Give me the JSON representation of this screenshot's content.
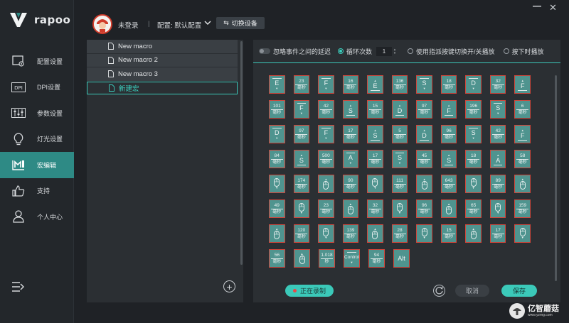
{
  "brand": {
    "name": "rapoo",
    "accent": "#3bc9b9",
    "active_nav": "#2e8a85",
    "cell_border": "#d0453a",
    "cell_fill": "#4f948f"
  },
  "sidebar": {
    "items": [
      {
        "label": "配置设置",
        "icon": "profile-settings-icon",
        "active": false
      },
      {
        "label": "DPI设置",
        "icon": "dpi-icon",
        "active": false
      },
      {
        "label": "参数设置",
        "icon": "sliders-icon",
        "active": false
      },
      {
        "label": "灯光设置",
        "icon": "bulb-icon",
        "active": false
      },
      {
        "label": "宏编辑",
        "icon": "macro-icon",
        "active": true
      },
      {
        "label": "支持",
        "icon": "thumbs-up-icon",
        "active": false
      },
      {
        "label": "个人中心",
        "icon": "user-icon",
        "active": false
      }
    ]
  },
  "header": {
    "login": "未登录",
    "separator": "|",
    "profile": "配置: 默认配置",
    "switch_device": "切换设备"
  },
  "macro_list": {
    "items": [
      "New macro",
      "New macro 2",
      "New macro 3",
      "新建宏"
    ],
    "selected_index": 3
  },
  "options": {
    "ignore_delay": "忽略事件之间的延迟",
    "loop_label": "循环次数",
    "loop_value": "1",
    "toggle_mode": "使用指派按键切换开/关播放",
    "hold_mode": "按下时播放"
  },
  "macro_cells": [
    [
      {
        "t": "key",
        "k": "E",
        "d": "down"
      },
      {
        "t": "delay",
        "v": "23",
        "u": "毫秒"
      },
      {
        "t": "key",
        "k": "F",
        "d": "down"
      },
      {
        "t": "delay",
        "v": "16",
        "u": "毫秒"
      },
      {
        "t": "key",
        "k": "E",
        "d": "up"
      },
      {
        "t": "delay",
        "v": "136",
        "u": "毫秒"
      },
      {
        "t": "key",
        "k": "S",
        "d": "down"
      },
      {
        "t": "delay",
        "v": "18",
        "u": "毫秒"
      },
      {
        "t": "key",
        "k": "D",
        "d": "down"
      },
      {
        "t": "delay",
        "v": "32",
        "u": "毫秒"
      },
      {
        "t": "key",
        "k": "F",
        "d": "up"
      }
    ],
    [
      {
        "t": "delay",
        "v": "101",
        "u": "毫秒"
      },
      {
        "t": "key",
        "k": "F",
        "d": "down"
      },
      {
        "t": "delay",
        "v": "42",
        "u": "毫秒"
      },
      {
        "t": "key",
        "k": "S",
        "d": "up"
      },
      {
        "t": "delay",
        "v": "15",
        "u": "毫秒"
      },
      {
        "t": "key",
        "k": "D",
        "d": "up"
      },
      {
        "t": "delay",
        "v": "97",
        "u": "毫秒"
      },
      {
        "t": "key",
        "k": "F",
        "d": "up"
      },
      {
        "t": "delay",
        "v": "196",
        "u": "毫秒"
      },
      {
        "t": "key",
        "k": "S",
        "d": "down"
      },
      {
        "t": "delay",
        "v": "6",
        "u": "毫秒"
      }
    ],
    [
      {
        "t": "key",
        "k": "D",
        "d": "down"
      },
      {
        "t": "delay",
        "v": "97",
        "u": "毫秒"
      },
      {
        "t": "key",
        "k": "F",
        "d": "down"
      },
      {
        "t": "delay",
        "v": "17",
        "u": "毫秒"
      },
      {
        "t": "key",
        "k": "S",
        "d": "up"
      },
      {
        "t": "delay",
        "v": "5",
        "u": "毫秒"
      },
      {
        "t": "key",
        "k": "D",
        "d": "up"
      },
      {
        "t": "delay",
        "v": "96",
        "u": "毫秒"
      },
      {
        "t": "key",
        "k": "S",
        "d": "down"
      },
      {
        "t": "delay",
        "v": "42",
        "u": "毫秒"
      },
      {
        "t": "key",
        "k": "F",
        "d": "up"
      }
    ],
    [
      {
        "t": "delay",
        "v": "84",
        "u": "毫秒"
      },
      {
        "t": "key",
        "k": "S",
        "d": "up"
      },
      {
        "t": "delay",
        "v": "500",
        "u": "毫秒"
      },
      {
        "t": "key",
        "k": "A",
        "d": "down"
      },
      {
        "t": "delay",
        "v": "17",
        "u": "毫秒"
      },
      {
        "t": "key",
        "k": "S",
        "d": "down"
      },
      {
        "t": "delay",
        "v": "45",
        "u": "毫秒"
      },
      {
        "t": "key",
        "k": "S",
        "d": "up"
      },
      {
        "t": "delay",
        "v": "18",
        "u": "毫秒"
      },
      {
        "t": "key",
        "k": "A",
        "d": "up"
      },
      {
        "t": "delay",
        "v": "58",
        "u": "毫秒"
      }
    ],
    [
      {
        "t": "mouse",
        "d": "down"
      },
      {
        "t": "delay",
        "v": "174",
        "u": "毫秒"
      },
      {
        "t": "mouse",
        "d": "up"
      },
      {
        "t": "delay",
        "v": "90",
        "u": "毫秒"
      },
      {
        "t": "mouse",
        "d": "down"
      },
      {
        "t": "delay",
        "v": "111",
        "u": "毫秒"
      },
      {
        "t": "mouse",
        "d": "up"
      },
      {
        "t": "delay",
        "v": "643",
        "u": "毫秒"
      },
      {
        "t": "mouse",
        "d": "down"
      },
      {
        "t": "delay",
        "v": "89",
        "u": "毫秒"
      },
      {
        "t": "mouse",
        "d": "up"
      }
    ],
    [
      {
        "t": "delay",
        "v": "49",
        "u": "毫秒"
      },
      {
        "t": "mouse",
        "d": "down"
      },
      {
        "t": "delay",
        "v": "23",
        "u": "毫秒"
      },
      {
        "t": "mouse",
        "d": "up"
      },
      {
        "t": "delay",
        "v": "32",
        "u": "毫秒"
      },
      {
        "t": "mouse",
        "d": "down"
      },
      {
        "t": "delay",
        "v": "96",
        "u": "毫秒"
      },
      {
        "t": "mouse",
        "d": "up"
      },
      {
        "t": "delay",
        "v": "65",
        "u": "毫秒"
      },
      {
        "t": "mouse",
        "d": "down"
      },
      {
        "t": "delay",
        "v": "159",
        "u": "毫秒"
      }
    ],
    [
      {
        "t": "mouse",
        "d": "up"
      },
      {
        "t": "delay",
        "v": "120",
        "u": "毫秒"
      },
      {
        "t": "mouse",
        "d": "down"
      },
      {
        "t": "delay",
        "v": "139",
        "u": "毫秒"
      },
      {
        "t": "mouse",
        "d": "up"
      },
      {
        "t": "delay",
        "v": "28",
        "u": "毫秒"
      },
      {
        "t": "mouse",
        "d": "down"
      },
      {
        "t": "delay",
        "v": "15",
        "u": "毫秒"
      },
      {
        "t": "mouse",
        "d": "up"
      },
      {
        "t": "delay",
        "v": "17",
        "u": "毫秒"
      },
      {
        "t": "mouse",
        "d": "down"
      }
    ],
    [
      {
        "t": "delay",
        "v": "56",
        "u": "毫秒"
      },
      {
        "t": "mouse",
        "d": "up"
      },
      {
        "t": "delay",
        "v": "1.018",
        "u": "秒"
      },
      {
        "t": "mod",
        "k": "Control",
        "d": "down"
      },
      {
        "t": "delay",
        "v": "94",
        "u": "毫秒"
      },
      {
        "t": "alt",
        "k": "Alt",
        "d": "none"
      }
    ]
  ],
  "footer": {
    "recording": "正在录制",
    "cancel": "取消",
    "save": "保存"
  },
  "watermark": {
    "title": "亿智蘑菇",
    "url": "www.yzmg.com"
  }
}
